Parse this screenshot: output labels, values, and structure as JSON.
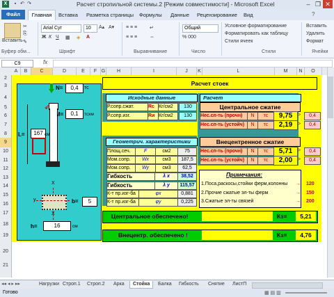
{
  "window": {
    "title": "Расчет стропильной системы.2 [Режим совместимости] - Microsoft Excel",
    "icon": "excel-icon"
  },
  "ribbon_tabs": [
    "Файл",
    "Главная",
    "Вставка",
    "Разметка страницы",
    "Формулы",
    "Данные",
    "Рецензирование",
    "Вид"
  ],
  "ribbon": {
    "paste_label": "Вставить",
    "clipboard_label": "Буфер обм...",
    "font_label": "Шрифт",
    "align_label": "Выравнивание",
    "number_label": "Число",
    "styles_label": "Стили",
    "cells_label": "Ячейки",
    "font_name": "Arial Cyr",
    "font_size": "10",
    "number_format": "Общий",
    "cond_format": "Условное форматирование",
    "format_table": "Форматировать как таблицу",
    "cell_styles": "Стили ячеек",
    "insert": "Вставить",
    "delete": "Удалить",
    "format": "Формат"
  },
  "formula_bar": {
    "name_box": "C9",
    "fx": "fx",
    "value": ""
  },
  "columns": [
    "A",
    "B",
    "C",
    "D",
    "E",
    "F",
    "G",
    "H",
    "I",
    "J",
    "K",
    "L",
    "M",
    "N",
    "O"
  ],
  "rows": [
    "2",
    "3",
    "4",
    "5",
    "6",
    "7",
    "8",
    "9",
    "10",
    "11",
    "12",
    "13",
    "14",
    "15",
    "16",
    "17",
    "18",
    "19",
    "20",
    "21"
  ],
  "sheet": {
    "title": "Расчет стоек",
    "left": {
      "N_label": "N=",
      "N_value": "0,4",
      "N_unit": "тс",
      "M_label": "M=",
      "M_value": "0,1",
      "M_unit": "тсхм",
      "L_label": "L=",
      "L_value": "167",
      "L_unit": "см",
      "x_top": "X",
      "y_label": "y",
      "b_label": "b=",
      "b_value": "5",
      "x_bottom": "X",
      "h_label": "h=",
      "h_value": "16",
      "h_unit": "см"
    },
    "initial": {
      "header": "Исходные данные",
      "rows": [
        {
          "label": "Р.сопр.сжат.",
          "sym": "Rc",
          "unit": "Кг/см2",
          "value": "130"
        },
        {
          "label": "Р.сопр.изг.",
          "sym": "Rи",
          "unit": "Кг/см2",
          "value": "130"
        }
      ]
    },
    "geom": {
      "header": "Геометрич. характеристики",
      "rows": [
        {
          "label": "Площ.сеч.",
          "sym": "F",
          "unit": "см2",
          "value": "75"
        },
        {
          "label": "Мом.сопр.",
          "sym": "Wx",
          "unit": "см3",
          "value": "187,5"
        },
        {
          "label": "Мом.сопр.",
          "sym": "Wy",
          "unit": "см3",
          "value": "62,5"
        }
      ],
      "flex_x_label": "Гибкость",
      "flex_x_sym": "λ x",
      "flex_x_value": "38,52",
      "flex_y_label": "Гибкость",
      "flex_y_sym": "λ y",
      "flex_y_value": "115,57",
      "phi_x_label": "К-т пр.изг-ба",
      "phi_x_sym": "φx",
      "phi_x_value": "0,881",
      "phi_y_label": "К-т пр.изг-ба",
      "phi_y_sym": "φy",
      "phi_y_value": "0,225"
    },
    "calc": {
      "header": "Расчет",
      "central": "Центральное сжатие",
      "central_rows": [
        {
          "label": "Нес.сп-ть (прочн)",
          "sym": "N",
          "unit": "тс",
          "value": "9,75",
          "cmp": ">",
          "ref": "0,4"
        },
        {
          "label": "Нес.сп-ть (устойч)",
          "sym": "N",
          "unit": "тс",
          "value": "2,19",
          "cmp": ">",
          "ref": "0,4"
        }
      ],
      "eccentric": "Внецентренное сжатие",
      "eccentric_rows": [
        {
          "label": "Нес.сп-ть (прочн)",
          "sym": "N",
          "unit": "тс",
          "value": "5,71",
          "cmp": ">",
          "ref": "0,4"
        },
        {
          "label": "Нес.сп-ть (устойч)",
          "sym": "N",
          "unit": "тс",
          "value": "2,00",
          "cmp": ">",
          "ref": "0,4"
        }
      ],
      "notes_header": "Примечания:",
      "notes": [
        {
          "text": "1.Поса,раскосы,стойки ферм,колонны",
          "arrow": "→",
          "value": "120"
        },
        {
          "text": "2.Прочие сжатые эл-ты ферм",
          "arrow": "→",
          "value": "150"
        },
        {
          "text": "3.Сжатые эл-ты связей",
          "arrow": "→",
          "value": "200"
        }
      ]
    },
    "result1": {
      "text": "Центральное обеспечено!",
      "k_label": "Кз=",
      "k_value": "5,21"
    },
    "result2": {
      "text": "Внецентр. обеспечено !",
      "k_label": "Кз=",
      "k_value": "4,76"
    }
  },
  "sheet_tabs": [
    "Нагрузки",
    "Строп.1",
    "Строп.2",
    "Арка",
    "Стойка",
    "Балка",
    "Гибкость",
    "Снятие",
    "ЛистП"
  ],
  "active_tab": "Стойка",
  "status": "Готово"
}
